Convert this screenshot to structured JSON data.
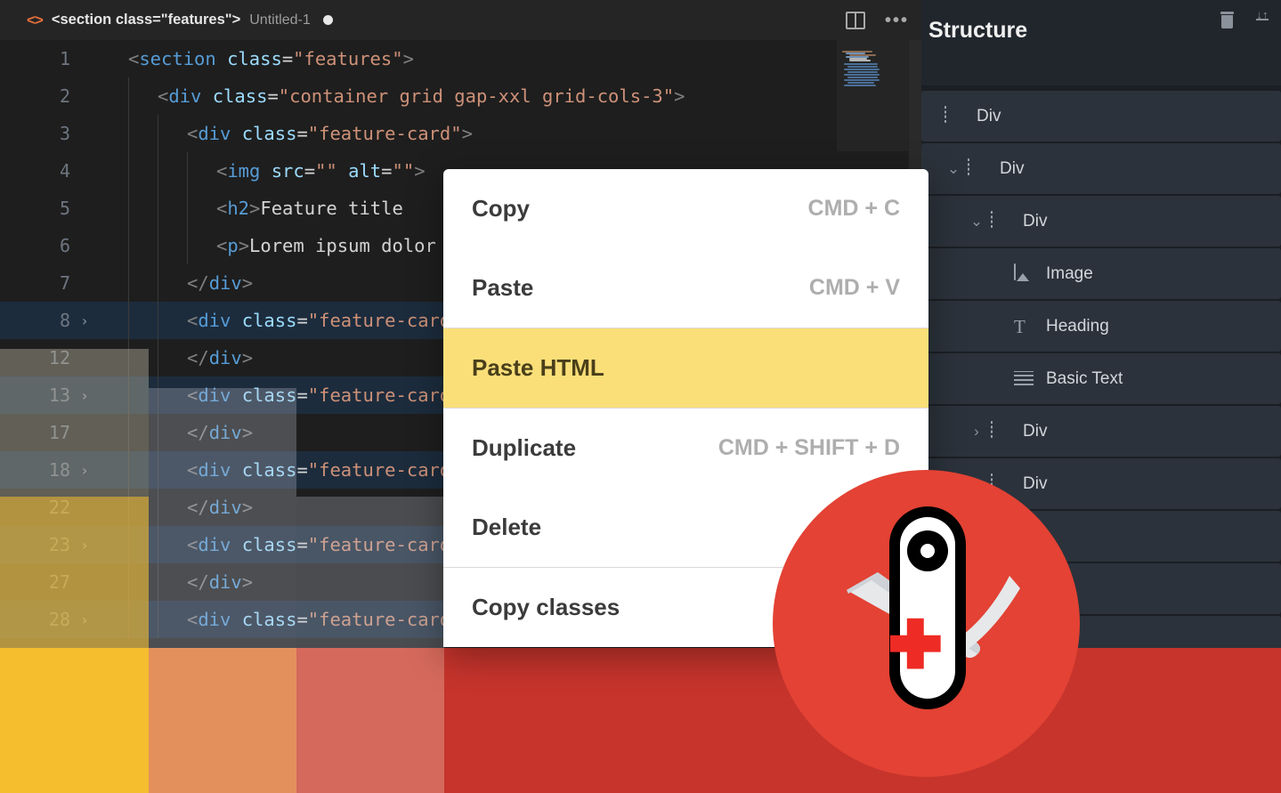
{
  "editor": {
    "titlebar": {
      "icon": "code-brackets-icon",
      "title": "<section class=\"features\">",
      "subtitle": "Untitled-1",
      "dirty_indicator": "●",
      "split_icon": "split-editor-icon",
      "more_icon": "•••"
    },
    "lines": [
      {
        "number": "1",
        "fold": "",
        "indent": 0,
        "selected": false,
        "tokens": [
          {
            "t": "<",
            "c": "tk-punct"
          },
          {
            "t": "section",
            "c": "tk-tag"
          },
          {
            "t": " ",
            "c": "tk-text"
          },
          {
            "t": "class",
            "c": "tk-attr"
          },
          {
            "t": "=",
            "c": "tk-eq"
          },
          {
            "t": "\"features\"",
            "c": "tk-str"
          },
          {
            "t": ">",
            "c": "tk-punct"
          }
        ]
      },
      {
        "number": "2",
        "fold": "",
        "indent": 1,
        "selected": false,
        "tokens": [
          {
            "t": "<",
            "c": "tk-punct"
          },
          {
            "t": "div",
            "c": "tk-tag"
          },
          {
            "t": " ",
            "c": "tk-text"
          },
          {
            "t": "class",
            "c": "tk-attr"
          },
          {
            "t": "=",
            "c": "tk-eq"
          },
          {
            "t": "\"container grid gap-xxl grid-cols-3\"",
            "c": "tk-str"
          },
          {
            "t": ">",
            "c": "tk-punct"
          }
        ]
      },
      {
        "number": "3",
        "fold": "",
        "indent": 2,
        "selected": false,
        "tokens": [
          {
            "t": "<",
            "c": "tk-punct"
          },
          {
            "t": "div",
            "c": "tk-tag"
          },
          {
            "t": " ",
            "c": "tk-text"
          },
          {
            "t": "class",
            "c": "tk-attr"
          },
          {
            "t": "=",
            "c": "tk-eq"
          },
          {
            "t": "\"feature-card\"",
            "c": "tk-str"
          },
          {
            "t": ">",
            "c": "tk-punct"
          }
        ]
      },
      {
        "number": "4",
        "fold": "",
        "indent": 3,
        "selected": false,
        "tokens": [
          {
            "t": "<",
            "c": "tk-punct"
          },
          {
            "t": "img",
            "c": "tk-tag"
          },
          {
            "t": " ",
            "c": "tk-text"
          },
          {
            "t": "src",
            "c": "tk-attr"
          },
          {
            "t": "=",
            "c": "tk-eq"
          },
          {
            "t": "\"\"",
            "c": "tk-str"
          },
          {
            "t": " ",
            "c": "tk-text"
          },
          {
            "t": "alt",
            "c": "tk-attr"
          },
          {
            "t": "=",
            "c": "tk-eq"
          },
          {
            "t": "\"\"",
            "c": "tk-str"
          },
          {
            "t": ">",
            "c": "tk-punct"
          }
        ]
      },
      {
        "number": "5",
        "fold": "",
        "indent": 3,
        "selected": false,
        "tokens": [
          {
            "t": "<",
            "c": "tk-punct"
          },
          {
            "t": "h2",
            "c": "tk-tag"
          },
          {
            "t": ">",
            "c": "tk-punct"
          },
          {
            "t": "Feature title",
            "c": "tk-text"
          }
        ]
      },
      {
        "number": "6",
        "fold": "",
        "indent": 3,
        "selected": false,
        "tokens": [
          {
            "t": "<",
            "c": "tk-punct"
          },
          {
            "t": "p",
            "c": "tk-tag"
          },
          {
            "t": ">",
            "c": "tk-punct"
          },
          {
            "t": "Lorem ipsum dolor",
            "c": "tk-text"
          }
        ]
      },
      {
        "number": "7",
        "fold": "",
        "indent": 2,
        "selected": false,
        "tokens": [
          {
            "t": "</",
            "c": "tk-punct"
          },
          {
            "t": "div",
            "c": "tk-tag"
          },
          {
            "t": ">",
            "c": "tk-punct"
          }
        ]
      },
      {
        "number": "8",
        "fold": "›",
        "indent": 2,
        "selected": true,
        "tokens": [
          {
            "t": "<",
            "c": "tk-punct"
          },
          {
            "t": "div",
            "c": "tk-tag"
          },
          {
            "t": " ",
            "c": "tk-text"
          },
          {
            "t": "class",
            "c": "tk-attr"
          },
          {
            "t": "=",
            "c": "tk-eq"
          },
          {
            "t": "\"feature-card\"",
            "c": "tk-str"
          },
          {
            "t": ">",
            "c": "tk-punct"
          }
        ]
      },
      {
        "number": "12",
        "fold": "",
        "indent": 2,
        "selected": false,
        "tokens": [
          {
            "t": "</",
            "c": "tk-punct"
          },
          {
            "t": "div",
            "c": "tk-tag"
          },
          {
            "t": ">",
            "c": "tk-punct"
          }
        ]
      },
      {
        "number": "13",
        "fold": "›",
        "indent": 2,
        "selected": true,
        "tokens": [
          {
            "t": "<",
            "c": "tk-punct"
          },
          {
            "t": "div",
            "c": "tk-tag"
          },
          {
            "t": " ",
            "c": "tk-text"
          },
          {
            "t": "class",
            "c": "tk-attr"
          },
          {
            "t": "=",
            "c": "tk-eq"
          },
          {
            "t": "\"feature-card\"",
            "c": "tk-str"
          },
          {
            "t": ">",
            "c": "tk-punct"
          }
        ]
      },
      {
        "number": "17",
        "fold": "",
        "indent": 2,
        "selected": false,
        "tokens": [
          {
            "t": "</",
            "c": "tk-punct"
          },
          {
            "t": "div",
            "c": "tk-tag"
          },
          {
            "t": ">",
            "c": "tk-punct"
          }
        ]
      },
      {
        "number": "18",
        "fold": "›",
        "indent": 2,
        "selected": true,
        "tokens": [
          {
            "t": "<",
            "c": "tk-punct"
          },
          {
            "t": "div",
            "c": "tk-tag"
          },
          {
            "t": " ",
            "c": "tk-text"
          },
          {
            "t": "class",
            "c": "tk-attr"
          },
          {
            "t": "=",
            "c": "tk-eq"
          },
          {
            "t": "\"feature-card\"",
            "c": "tk-str"
          },
          {
            "t": ">",
            "c": "tk-punct"
          }
        ]
      },
      {
        "number": "22",
        "fold": "",
        "indent": 2,
        "selected": false,
        "tokens": [
          {
            "t": "</",
            "c": "tk-punct"
          },
          {
            "t": "div",
            "c": "tk-tag"
          },
          {
            "t": ">",
            "c": "tk-punct"
          }
        ]
      },
      {
        "number": "23",
        "fold": "›",
        "indent": 2,
        "selected": true,
        "tokens": [
          {
            "t": "<",
            "c": "tk-punct"
          },
          {
            "t": "div",
            "c": "tk-tag"
          },
          {
            "t": " ",
            "c": "tk-text"
          },
          {
            "t": "class",
            "c": "tk-attr"
          },
          {
            "t": "=",
            "c": "tk-eq"
          },
          {
            "t": "\"feature-card\"",
            "c": "tk-str"
          },
          {
            "t": ">",
            "c": "tk-punct"
          }
        ]
      },
      {
        "number": "27",
        "fold": "",
        "indent": 2,
        "selected": false,
        "tokens": [
          {
            "t": "</",
            "c": "tk-punct"
          },
          {
            "t": "div",
            "c": "tk-tag"
          },
          {
            "t": ">",
            "c": "tk-punct"
          }
        ]
      },
      {
        "number": "28",
        "fold": "›",
        "indent": 2,
        "selected": true,
        "tokens": [
          {
            "t": "<",
            "c": "tk-punct"
          },
          {
            "t": "div",
            "c": "tk-tag"
          },
          {
            "t": " ",
            "c": "tk-text"
          },
          {
            "t": "class",
            "c": "tk-attr"
          },
          {
            "t": "=",
            "c": "tk-eq"
          },
          {
            "t": "\"feature-card\"",
            "c": "tk-str"
          },
          {
            "t": ">",
            "c": "tk-punct"
          }
        ]
      }
    ],
    "minimap": {
      "name": "minimap"
    }
  },
  "context_menu": {
    "items": [
      {
        "label": "Copy",
        "shortcut": "CMD + C",
        "highlight": false,
        "sep_after": false
      },
      {
        "label": "Paste",
        "shortcut": "CMD + V",
        "highlight": false,
        "sep_after": true
      },
      {
        "label": "Paste HTML",
        "shortcut": "",
        "highlight": true,
        "sep_after": true
      },
      {
        "label": "Duplicate",
        "shortcut": "CMD + SHIFT + D",
        "highlight": false,
        "sep_after": false
      },
      {
        "label": "Delete",
        "shortcut": "",
        "highlight": false,
        "sep_after": true
      },
      {
        "label": "Copy classes",
        "shortcut": "",
        "highlight": false,
        "sep_after": false
      }
    ]
  },
  "structure": {
    "title": "Structure",
    "actions": [
      {
        "icon": "trash-icon"
      },
      {
        "icon": "collapse-all-icon"
      }
    ],
    "tree": [
      {
        "label": "Div",
        "icon": "div-icon",
        "indent": 0,
        "chevron": "",
        "empty": false
      },
      {
        "label": "Div",
        "icon": "div-icon",
        "indent": 1,
        "chevron": "⌄",
        "empty": false
      },
      {
        "label": "Div",
        "icon": "div-icon",
        "indent": 2,
        "chevron": "⌄",
        "empty": false
      },
      {
        "label": "Image",
        "icon": "image-icon",
        "indent": 3,
        "chevron": "",
        "empty": false
      },
      {
        "label": "Heading",
        "icon": "heading-icon",
        "indent": 3,
        "chevron": "",
        "empty": false
      },
      {
        "label": "Basic Text",
        "icon": "text-icon",
        "indent": 3,
        "chevron": "",
        "empty": false
      },
      {
        "label": "Div",
        "icon": "div-icon",
        "indent": 2,
        "chevron": "›",
        "empty": false
      },
      {
        "label": "Div",
        "icon": "div-icon",
        "indent": 2,
        "chevron": "",
        "empty": false
      },
      {
        "label": "",
        "icon": "",
        "indent": 2,
        "chevron": "",
        "empty": true
      },
      {
        "label": "",
        "icon": "",
        "indent": 2,
        "chevron": "",
        "empty": true
      },
      {
        "label": "",
        "icon": "",
        "indent": 2,
        "chevron": "",
        "empty": true
      }
    ]
  },
  "color_blocks": [
    {
      "name": "swatch-yellow",
      "hex": "#F5BE2E"
    },
    {
      "name": "swatch-orange",
      "hex": "#E4905C"
    },
    {
      "name": "swatch-salmon",
      "hex": "#D5695C"
    },
    {
      "name": "swatch-red",
      "hex": "#C6342C"
    }
  ],
  "logo": {
    "name": "swiss-army-knife-logo",
    "background": "#E34234",
    "accent": "#EE2B24"
  }
}
